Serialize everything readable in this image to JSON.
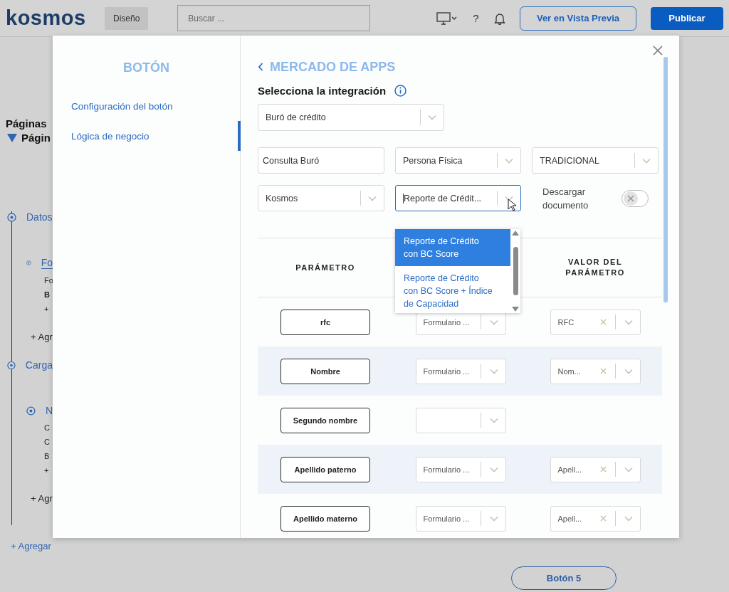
{
  "topbar": {
    "logo": "kosmos",
    "mode_tab": "Diseño",
    "search": {
      "placeholder": "Buscar ..."
    },
    "help": "?",
    "preview_button": "Ver en Vista Previa",
    "publish_button": "Publicar"
  },
  "outline": {
    "title": "Páginas",
    "page": "Págin",
    "steps": [
      {
        "label": "Datos",
        "forms": [
          {
            "label": "Fo",
            "selected": true,
            "items": [
              {
                "text": "Fo",
                "selected": false
              },
              {
                "text": "B",
                "selected": true
              },
              {
                "text": "+",
                "selected": false
              }
            ]
          }
        ],
        "add": "+ Agr"
      },
      {
        "label": "Carga",
        "forms": [
          {
            "label": "N",
            "selected": false,
            "items": [
              {
                "text": "C",
                "selected": false
              },
              {
                "text": "C",
                "selected": false
              },
              {
                "text": "B",
                "selected": false
              },
              {
                "text": "+",
                "selected": false
              }
            ]
          }
        ],
        "add": "+ Agr"
      }
    ],
    "add_step": "+ Agregar"
  },
  "modal": {
    "nav_title": "BOTÓN",
    "nav_items": [
      {
        "label": "Configuración del botón",
        "selected": false
      },
      {
        "label": "Lógica de negocio",
        "selected": true
      }
    ],
    "back_title": "MERCADO DE APPS",
    "section_title": "Selecciona la integración",
    "integration": "Buró de crédito",
    "fields": [
      {
        "kind": "text",
        "value": "Consulta Buró",
        "focused": false
      },
      {
        "kind": "select",
        "value": "Persona Física",
        "focused": false
      },
      {
        "kind": "select",
        "value": "TRADICIONAL",
        "focused": false
      },
      {
        "kind": "select",
        "value": "Kosmos",
        "focused": false
      },
      {
        "kind": "select",
        "value": "Reporte de Crédit...",
        "focused": true
      },
      {
        "kind": "toggle",
        "label": "Descargar documento",
        "on": false
      }
    ],
    "dropdown": [
      {
        "label": "Reporte de Crédito con BC Score",
        "selected": true
      },
      {
        "label": "Reporte de Crédito con BC Score + Índice de Capacidad",
        "selected": false
      }
    ],
    "table": {
      "column_1": "PARÁMETRO",
      "column_3": "VALOR DEL PARÁMETRO",
      "rows": [
        {
          "kind": "mapped",
          "parameter": "rfc",
          "source": "Formulario ...",
          "value": "RFC"
        },
        {
          "kind": "mapped",
          "parameter": "Nombre",
          "source": "Formulario ...",
          "value": "Nom..."
        },
        {
          "kind": "unmapped",
          "parameter": "Segundo nombre"
        },
        {
          "kind": "mapped",
          "parameter": "Apellido paterno",
          "source": "Formulario ...",
          "value": "Apell..."
        },
        {
          "kind": "mapped",
          "parameter": "Apellido materno",
          "source": "Formulario ...",
          "value": "Apell..."
        }
      ]
    }
  },
  "bottom_button": "Botón 5"
}
